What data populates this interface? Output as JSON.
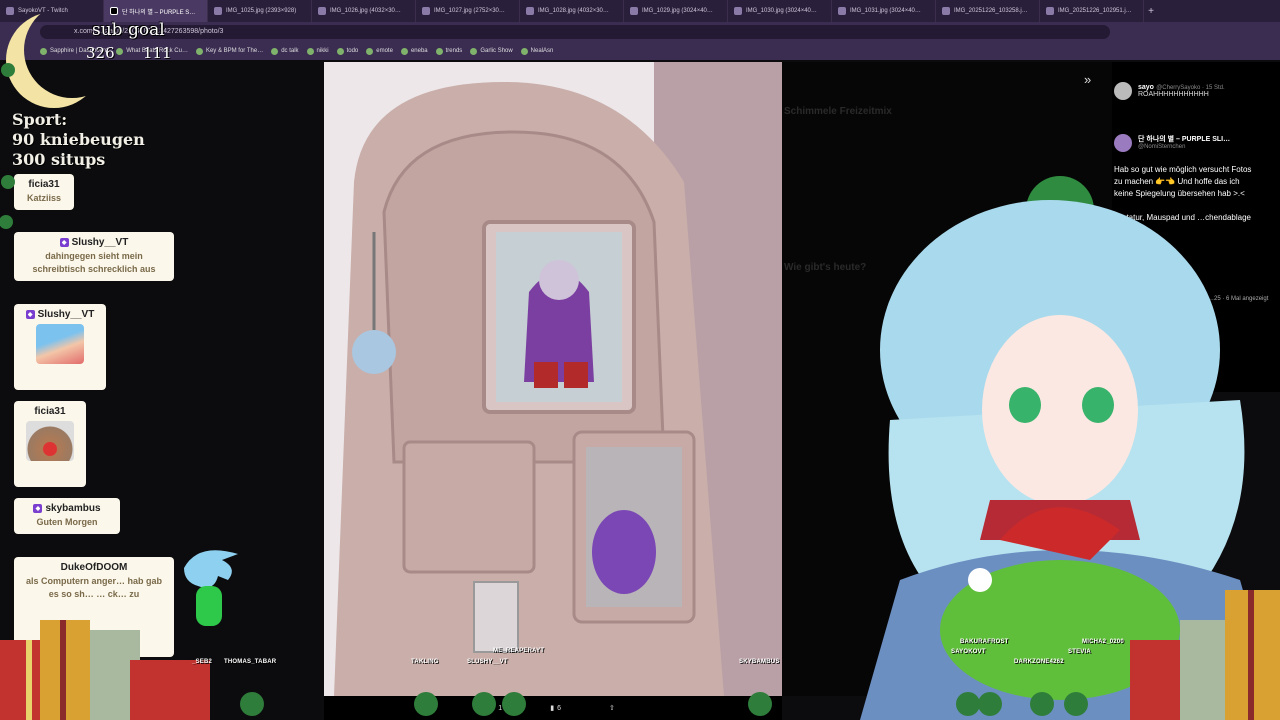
{
  "browser": {
    "tabs": [
      {
        "label": "SayokoVT - Twitch",
        "active": false
      },
      {
        "label": "단 하나의 별 – PURPLE S…",
        "active": true
      },
      {
        "label": "IMG_1025.jpg (2393×928)",
        "active": false
      },
      {
        "label": "IMG_1026.jpg (4032×30…",
        "active": false
      },
      {
        "label": "IMG_1027.jpg (2752×30…",
        "active": false
      },
      {
        "label": "IMG_1028.jpg (4032×30…",
        "active": false
      },
      {
        "label": "IMG_1029.jpg (3024×40…",
        "active": false
      },
      {
        "label": "IMG_1030.jpg (3024×40…",
        "active": false
      },
      {
        "label": "IMG_1031.jpg (3024×40…",
        "active": false
      },
      {
        "label": "IMG_20251226_103258.j…",
        "active": false
      },
      {
        "label": "IMG_20251226_102951.j…",
        "active": false
      }
    ],
    "url": "x.com/…/status/2004781513427263598/photo/3",
    "bookmarks": [
      "Sapphire | Dashboard",
      "What Beats Rock Cu…",
      "Key & BPM for The…",
      "dc talk",
      "nikki",
      "todo",
      "emote",
      "eneba",
      "trends",
      "Garlic Show",
      "NealAsn"
    ]
  },
  "overlay": {
    "subgoal_label": "sub goal",
    "sub_current": "326",
    "sub_target": "111",
    "sport_title": "Sport:",
    "sport_line1": "90 kniebeugen",
    "sport_line2": "300 situps"
  },
  "chat": [
    {
      "user": "ficia31",
      "message": "Katziiss",
      "badge": false
    },
    {
      "user": "Slushy__VT",
      "message": "dahingegen sieht mein schreibtisch schrecklich aus",
      "badge": true
    },
    {
      "user": "Slushy__VT",
      "message": "",
      "badge": true,
      "emote": "blue-hair-emote"
    },
    {
      "user": "ficia31",
      "message": "",
      "badge": false,
      "emote": "cat-emote"
    },
    {
      "user": "skybambus",
      "message": "Guten Morgen",
      "badge": true
    },
    {
      "user": "DukeOfDOOM",
      "message": "als Computern anger… hab gab es so sh… … ck… zu",
      "badge": false
    }
  ],
  "twitter": {
    "likes": "1",
    "views": "6",
    "tweet1": {
      "name": "sayo",
      "handle": "@CherrySayoko · 15 Std.",
      "text": "ROAHHHHHHHHHHH"
    },
    "tweet2": {
      "name": "단 하나의 별 – PURPLE SLI…",
      "handle": "@NomiSternchen",
      "text": "Hab so gut wie möglich versucht Fotos zu machen 👉👈 Und hoffe das ich keine Spiegelung übersehen hab >.<",
      "list": [
        "Tastatur, Mauspad und …chendablage",
        "…ssen",
        "…Noch nicht"
      ],
      "meta": "…25 · 6 Mal angezeigt"
    },
    "faded_labels": [
      "Schimmele Freizeitmix",
      "Wie gibt's heute?"
    ]
  },
  "usernames_bottom": [
    "_SEB2",
    "THOMAS_TABAR",
    "TAKLING",
    "SLUSHY__VT",
    "ME_REAPERAYT",
    "SKYBAMBUS",
    "BAKURAFROST",
    "SAYOKOVT",
    "MICHA2_0200",
    "STEVIA",
    "DARKZONE4262"
  ],
  "colors": {
    "chat_bg": "#fbf7ea",
    "sub_badge": "#7b3fd0",
    "browser": "#3b2d52",
    "bag": "#c9aea9"
  }
}
